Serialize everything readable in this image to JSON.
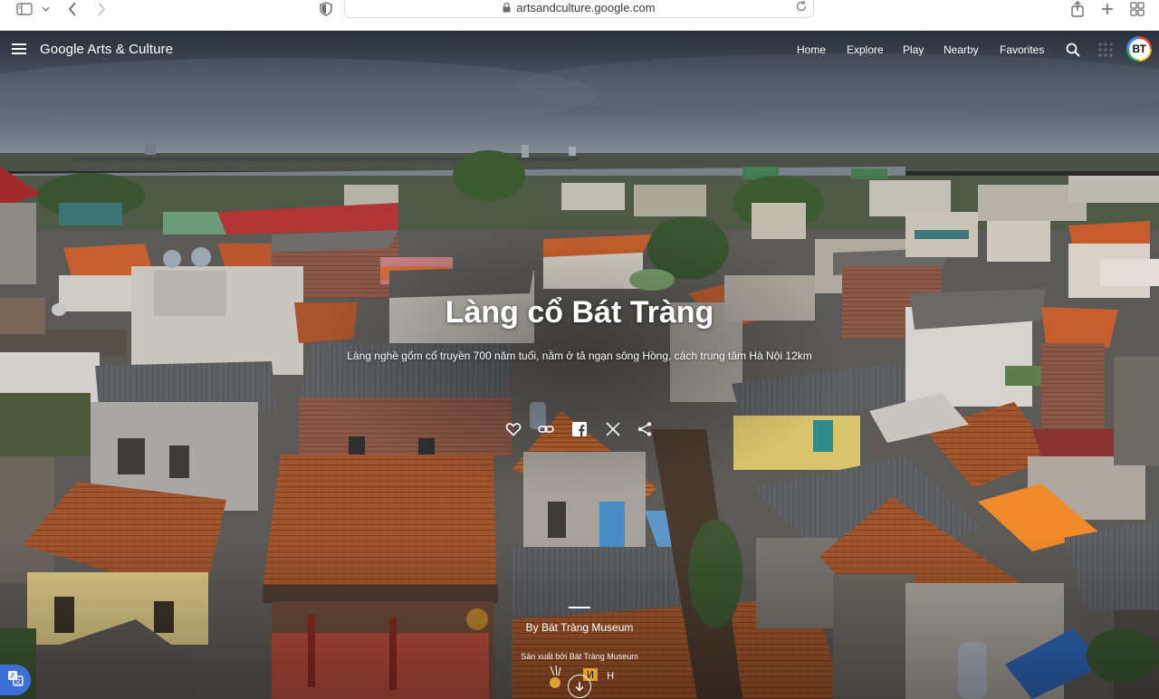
{
  "browser": {
    "url": "artsandculture.google.com"
  },
  "header": {
    "brand": "Google Arts & Culture",
    "nav": {
      "home": "Home",
      "explore": "Explore",
      "play": "Play",
      "nearby": "Nearby",
      "favorites": "Favorites"
    },
    "avatar_initials": "BT"
  },
  "story": {
    "title": "Làng cổ Bát Tràng",
    "subtitle": "Làng nghề gốm cổ truyền 700 năm tuổi, nằm ở tả ngạn sông Hồng, cách trung tâm Hà Nội 12km",
    "byline": "By Bát Tràng Museum",
    "produced_by": "Sản xuất bởi Bát Tràng Museum"
  },
  "icons": {
    "like": "heart-icon",
    "link": "link-icon",
    "facebook": "facebook-icon",
    "x": "x-icon",
    "share": "share-icon",
    "scroll": "chevron-down-icon",
    "translate": "translate-icon"
  }
}
